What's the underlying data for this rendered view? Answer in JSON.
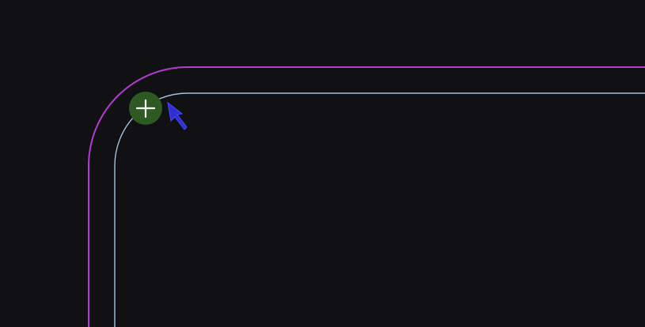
{
  "app": {
    "title": ""
  },
  "canvas": {
    "background_color": "#111113"
  },
  "board_outline": {
    "color": "#b23bd6"
  },
  "keepout_outline": {
    "color": "#9fc3e0"
  },
  "snap_marker": {
    "color": "#2d5a22",
    "icon": "crosshair-icon"
  },
  "cursor": {
    "color": "#2f2fd0",
    "icon": "arrow-cursor-icon"
  }
}
